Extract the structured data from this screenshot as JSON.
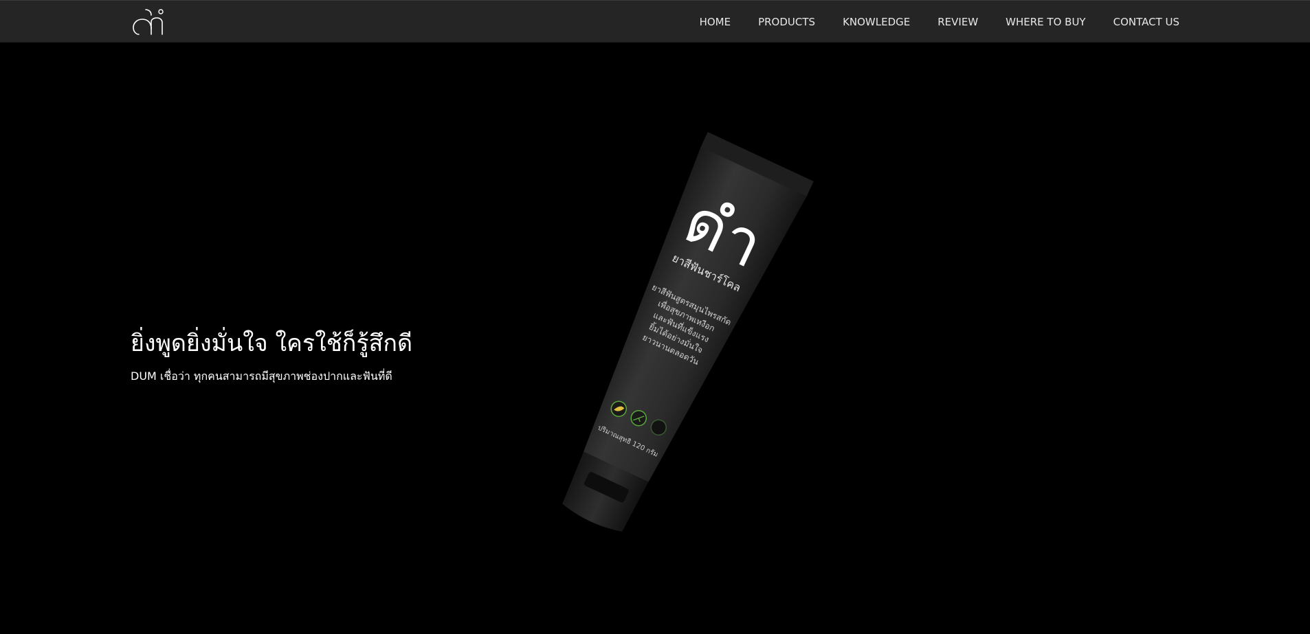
{
  "header": {
    "nav": {
      "home": "HOME",
      "products": "PRODUCTS",
      "knowledge": "KNOWLEDGE",
      "review": "REVIEW",
      "where_to_buy": "WHERE TO BUY",
      "contact_us": "CONTACT US"
    }
  },
  "hero": {
    "title": "ยิ่งพูดยิ่งมั่นใจ ใครใช้ก็รู้สึกดี",
    "subtitle": "DUM เชื่อว่า ทุกคนสามารถมีสุขภาพช่องปากและฟันที่ดี"
  },
  "product": {
    "brand": "ดำ",
    "name": "ยาสีฟันชาร์โคล",
    "description_lines": [
      "ยาสีฟันสูตรสมุนไพรสกัด",
      "เพื่อสุขภาพเหงือก",
      "และฟันที่แข็งแรง",
      "ยิ้มได้อย่างมั่นใจ",
      "ยาวนานตลอดวัน"
    ],
    "net_content": "ปริมาณสุทธิ 120 กรัม"
  },
  "colors": {
    "navbar_bg": "#252525",
    "page_bg": "#000000",
    "tube": "#2b2b2b",
    "accent_green": "#5aa83a"
  }
}
